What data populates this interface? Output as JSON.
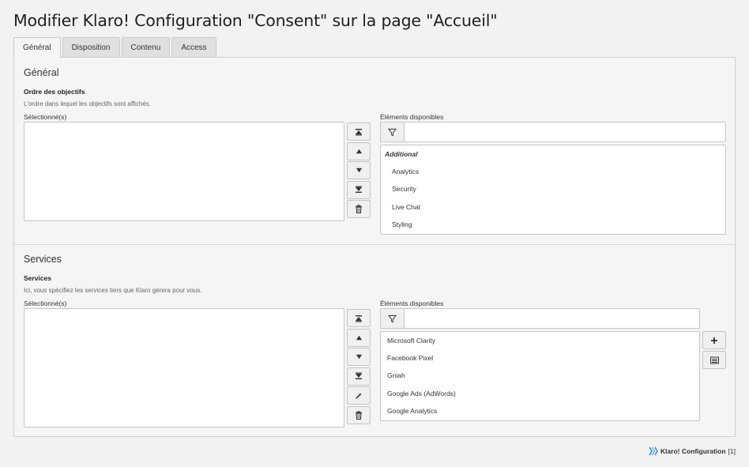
{
  "page": {
    "title": "Modifier Klaro! Configuration \"Consent\" sur la page \"Accueil\""
  },
  "tabs": [
    {
      "label": "Général",
      "active": true
    },
    {
      "label": "Disposition",
      "active": false
    },
    {
      "label": "Contenu",
      "active": false
    },
    {
      "label": "Access",
      "active": false
    }
  ],
  "general": {
    "section_title": "Général",
    "field_label": "Ordre des objectifs",
    "field_desc": "L'ordre dans lequel les objectifs sont affichés.",
    "selected_label": "Sélectionné(s)",
    "available_label": "Éléments disponibles",
    "filter_placeholder": "",
    "available": {
      "group": "Additional",
      "items": [
        "Analytics",
        "Security",
        "Live Chat",
        "Styling"
      ]
    },
    "controls": [
      "move-top-icon",
      "move-up-icon",
      "move-down-icon",
      "move-bottom-icon",
      "trash-icon"
    ]
  },
  "services": {
    "section_title": "Services",
    "field_label": "Services",
    "field_desc": "Ici, vous spécifiez les services tiers que Klaro gérera pour vous.",
    "selected_label": "Sélectionné(s)",
    "available_label": "Éléments disponibles",
    "filter_placeholder": "",
    "available_items": [
      "Microsoft Clarity",
      "Facebook Pixel",
      "Gniah",
      "Google Ads (AdWords)",
      "Google Analytics"
    ],
    "controls": [
      "move-top-icon",
      "move-up-icon",
      "move-down-icon",
      "move-bottom-icon",
      "pencil-icon",
      "trash-icon"
    ],
    "side_buttons": [
      "plus-icon",
      "list-icon"
    ]
  },
  "footer": {
    "label": "Klaro! Configuration",
    "uid": "[1]"
  },
  "colors": {
    "background": "#f2f2f2",
    "panel": "#f5f5f5",
    "logo": "#3a8fd8"
  }
}
